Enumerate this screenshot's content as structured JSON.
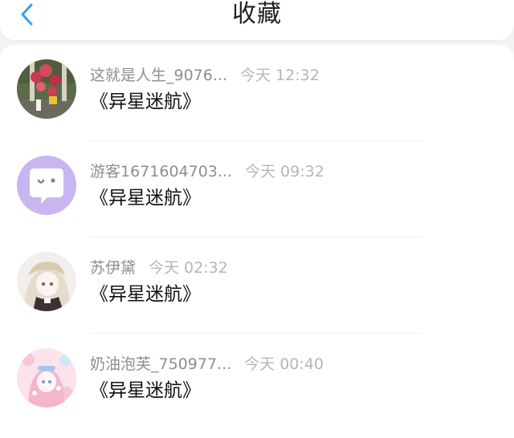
{
  "header": {
    "title": "收藏",
    "back_icon": "chevron-left-icon",
    "accent_color": "#3a9bf5"
  },
  "favorites": [
    {
      "user": "这就是人生_9076...",
      "time": "今天 12:32",
      "content": "《异星迷航》",
      "avatar": "photo-avatar-flowers"
    },
    {
      "user": "游客1671604703...",
      "time": "今天 09:32",
      "content": "《异星迷航》",
      "avatar": "default-chat-avatar"
    },
    {
      "user": "苏伊黛",
      "time": "今天 02:32",
      "content": "《异星迷航》",
      "avatar": "anime-avatar-girl"
    },
    {
      "user": "奶油泡芙_750977...",
      "time": "今天 00:40",
      "content": "《异星迷航》",
      "avatar": "anime-avatar-pink"
    }
  ]
}
